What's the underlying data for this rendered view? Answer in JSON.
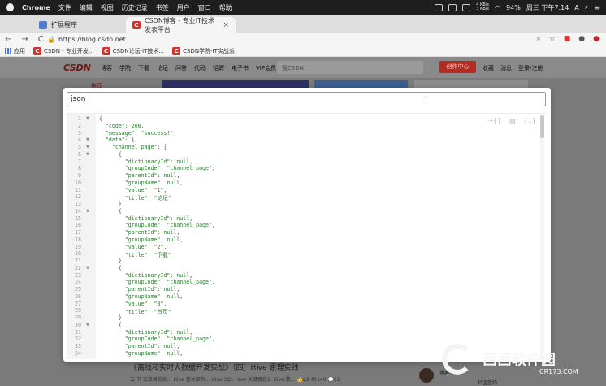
{
  "menubar": {
    "app": "Chrome",
    "items": [
      "文件",
      "编辑",
      "视图",
      "历史记录",
      "书签",
      "用户",
      "窗口",
      "帮助"
    ],
    "battery": "94%",
    "clock": "周三 下午7:14",
    "net_up": "4 KB/s",
    "net_down": "3 KB/s",
    "user": "A"
  },
  "tabs": [
    {
      "label": "扩展程序"
    },
    {
      "label": "CSDN博客 - 专业IT技术发表平台"
    }
  ],
  "url": "https://blog.csdn.net",
  "bookmarks": [
    "应用",
    "CSDN - 专业开发...",
    "CSDN论坛-IT技术...",
    "CSDN学院-IT实战派"
  ],
  "csdn": {
    "logo": "CSDN",
    "nav": [
      "博客",
      "学院",
      "下载",
      "论坛",
      "问答",
      "代码",
      "招聘",
      "电子书",
      "VIP会员"
    ],
    "search_placeholder": "搜CSDN",
    "create": "创作中心",
    "right": [
      "收藏",
      "消息",
      "登录/注册"
    ],
    "recommend": "推荐"
  },
  "modal": {
    "query": "json",
    "tools": [
      "⇢{}",
      "▤",
      "{..}"
    ]
  },
  "bottom": {
    "title": "《离线和实时大数据开发实战》（四）Hive 原理实践",
    "meta": "云 书   文章目前后... Hive 基本架构... Hive SQL Hive 关键概念1. Hive 数...",
    "likes": "22",
    "views": "140",
    "comments": "22",
    "author": "博客 4014",
    "author2": "社区签约"
  },
  "watermark": {
    "text": "西西软件园",
    "url": "CR173.COM"
  }
}
